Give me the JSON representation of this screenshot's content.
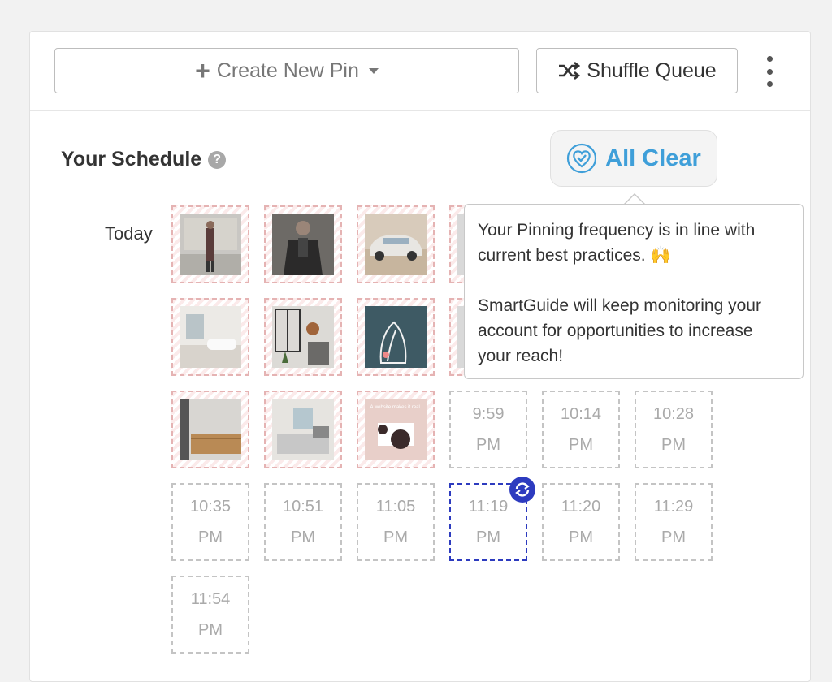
{
  "toolbar": {
    "create_label": "Create New Pin",
    "shuffle_label": "Shuffle Queue"
  },
  "schedule": {
    "title": "Your Schedule",
    "help_glyph": "?",
    "day_label": "Today"
  },
  "status": {
    "label": "All Clear",
    "accent_color": "#3f9fd9"
  },
  "tooltip": {
    "line1": "Your Pinning frequency is in line with current best practices. 🙌",
    "line2": "SmartGuide will keep monitoring your account for opportunities to increase your reach!"
  },
  "pins": [
    {
      "subject": "man in coat in front of building"
    },
    {
      "subject": "man in leather jacket"
    },
    {
      "subject": "vintage convertible car"
    },
    {
      "subject": "pin"
    },
    {
      "subject": "white bathroom"
    },
    {
      "subject": "dark bathroom"
    },
    {
      "subject": "illustrated plant poster"
    },
    {
      "subject": "pin"
    },
    {
      "subject": "wooden shelf"
    },
    {
      "subject": "bathroom with window"
    },
    {
      "subject": "website promo"
    }
  ],
  "pin_text": {
    "website_promo": "A website makes it real."
  },
  "empty_slots": [
    {
      "time": "9:59",
      "period": "PM"
    },
    {
      "time": "10:14",
      "period": "PM"
    },
    {
      "time": "10:28",
      "period": "PM"
    },
    {
      "time": "10:35",
      "period": "PM"
    },
    {
      "time": "10:51",
      "period": "PM"
    },
    {
      "time": "11:05",
      "period": "PM"
    },
    {
      "time": "11:19",
      "period": "PM"
    },
    {
      "time": "11:20",
      "period": "PM"
    },
    {
      "time": "11:29",
      "period": "PM"
    },
    {
      "time": "11:54",
      "period": "PM"
    }
  ]
}
